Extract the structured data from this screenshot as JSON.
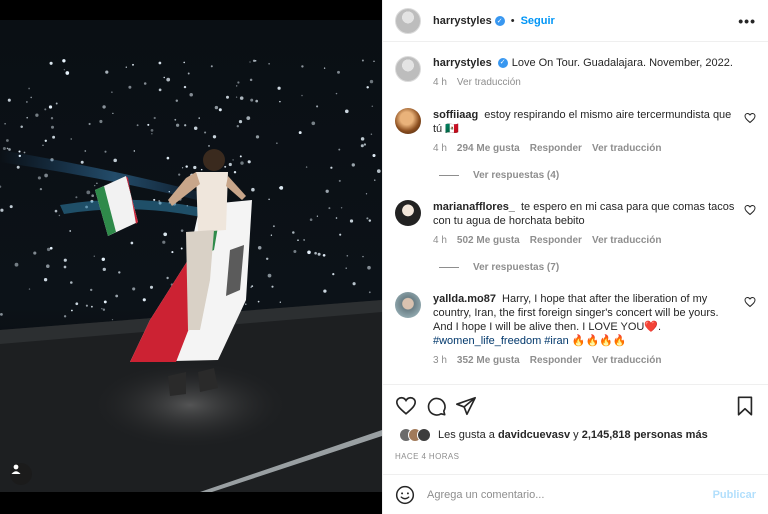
{
  "header": {
    "username": "harrystyles",
    "separator": "•",
    "follow_label": "Seguir",
    "more_label": "•••"
  },
  "caption": {
    "username": "harrystyles",
    "text": "Love On Tour. Guadalajara. November, 2022.",
    "time": "4 h",
    "translate": "Ver traducción"
  },
  "comments": [
    {
      "username": "soffiiaag",
      "text": "estoy respirando el mismo aire tercermundista que tú 🇲🇽",
      "time": "4 h",
      "likes": "294 Me gusta",
      "reply": "Responder",
      "translate": "Ver traducción",
      "replies": "Ver respuestas (4)"
    },
    {
      "username": "marianafflores_",
      "text": "te espero en mi casa para que comas tacos con tu agua de horchata bebito",
      "time": "4 h",
      "likes": "502 Me gusta",
      "reply": "Responder",
      "translate": "Ver traducción",
      "replies": "Ver respuestas (7)"
    },
    {
      "username": "yallda.mo87",
      "text": "Harry, I hope that after the liberation of my country, Iran, the first foreign singer's concert will be yours. And I hope I will be alive then. I LOVE YOU❤️.",
      "hashtags": "#women_life_freedom #iran 🔥🔥🔥🔥",
      "time": "3 h",
      "likes": "352 Me gusta",
      "reply": "Responder",
      "translate": "Ver traducción"
    }
  ],
  "likes": {
    "prefix": "Les gusta a",
    "user": "davidcuevasv",
    "middle": "y",
    "count": "2,145,818 personas más"
  },
  "timestamp": "HACE 4 HORAS",
  "add_comment": {
    "placeholder": "Agrega un comentario...",
    "publish_label": "Publicar"
  },
  "icons": {
    "emoji": "smiley-icon",
    "like": "heart-icon",
    "comment": "comment-icon",
    "share": "paper-plane-icon",
    "save": "bookmark-icon",
    "tags": "user-tag-icon",
    "verified": "verified-badge-icon"
  },
  "colors": {
    "accent": "#0095f6",
    "verified": "#3897f0",
    "muted": "#8e8e8e",
    "hashtag": "#00376b",
    "publish_disabled": "#b2dffc"
  }
}
